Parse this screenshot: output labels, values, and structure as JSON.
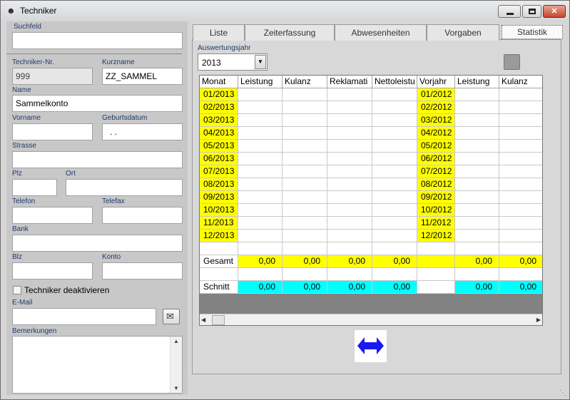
{
  "window": {
    "title": "Techniker",
    "app_icon": "technician-icon"
  },
  "form": {
    "suchfeld_label": "Suchfeld",
    "suchfeld_value": "",
    "techniker_nr_label": "Techniker-Nr.",
    "techniker_nr_value": "999",
    "kurzname_label": "Kurzname",
    "kurzname_value": "ZZ_SAMMEL",
    "name_label": "Name",
    "name_value": "Sammelkonto",
    "vorname_label": "Vorname",
    "vorname_value": "",
    "geburtsdatum_label": "Geburtsdatum",
    "geburtsdatum_value": " .  .",
    "strasse_label": "Strasse",
    "strasse_value": "",
    "plz_label": "Plz",
    "plz_value": "",
    "ort_label": "Ort",
    "ort_value": "",
    "telefon_label": "Telefon",
    "telefon_value": "",
    "telefax_label": "Telefax",
    "telefax_value": "",
    "bank_label": "Bank",
    "bank_value": "",
    "blz_label": "Blz",
    "blz_value": "",
    "konto_label": "Konto",
    "konto_value": "",
    "deaktivieren_label": "Techniker deaktivieren",
    "email_label": "E-Mail",
    "email_value": "",
    "bemerkungen_label": "Bemerkungen",
    "bemerkungen_value": ""
  },
  "tabs": [
    "Liste",
    "Zeiterfassung",
    "Abwesenheiten",
    "Vorgaben",
    "Statistik"
  ],
  "active_tab": "Statistik",
  "statistik": {
    "year_label": "Auswertungsjahr",
    "year_value": "2013",
    "columns": [
      "Monat",
      "Leistung",
      "Kulanz",
      "Reklamati",
      "Nettoleistu",
      "Vorjahr",
      "Leistung",
      "Kulanz"
    ],
    "months_current": [
      "01/2013",
      "02/2013",
      "03/2013",
      "04/2013",
      "05/2013",
      "06/2013",
      "07/2013",
      "08/2013",
      "09/2013",
      "10/2013",
      "11/2013",
      "12/2013"
    ],
    "months_prior": [
      "01/2012",
      "02/2012",
      "03/2012",
      "04/2012",
      "05/2012",
      "06/2012",
      "07/2012",
      "08/2012",
      "09/2012",
      "10/2012",
      "11/2012",
      "12/2012"
    ],
    "gesamt_label": "Gesamt",
    "gesamt_values": [
      "0,00",
      "0,00",
      "0,00",
      "0,00",
      "",
      "0,00",
      "0,00"
    ],
    "schnitt_label": "Schnitt",
    "schnitt_values": [
      "0,00",
      "0,00",
      "0,00",
      "0,00",
      "",
      "0,00",
      "0,00"
    ]
  },
  "colors": {
    "yellow": "#ffff00",
    "cyan": "#00ffff",
    "arrow": "#1a1af0"
  }
}
